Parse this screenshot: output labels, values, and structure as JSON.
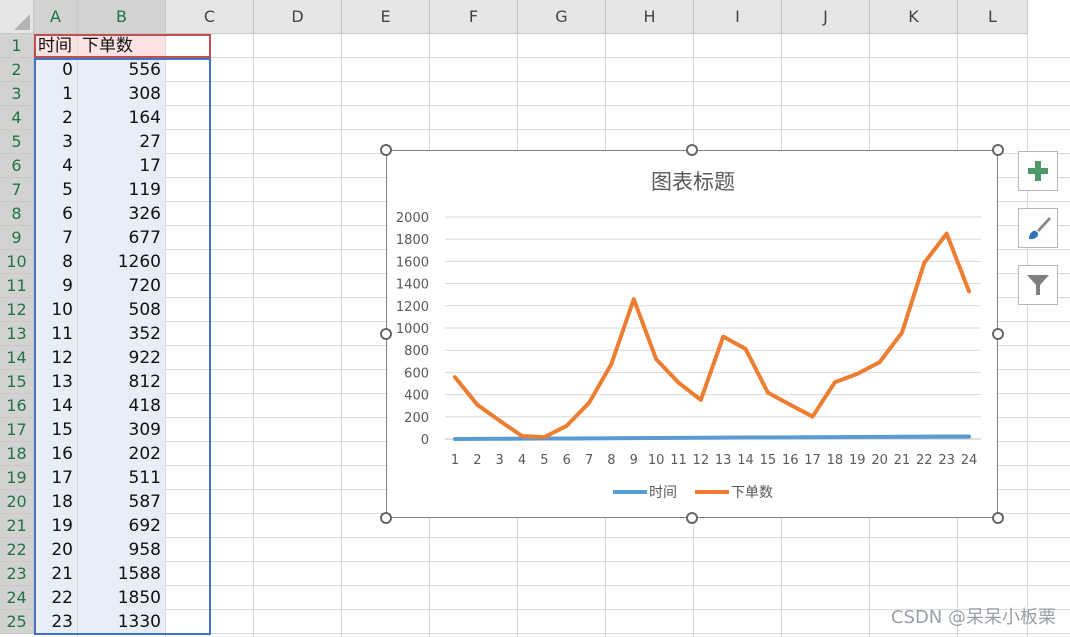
{
  "columns": [
    "A",
    "B",
    "C",
    "D",
    "E",
    "F",
    "G",
    "H",
    "I",
    "J",
    "K",
    "L"
  ],
  "rows": [
    "1",
    "2",
    "3",
    "4",
    "5",
    "6",
    "7",
    "8",
    "9",
    "10",
    "11",
    "12",
    "13",
    "14",
    "15",
    "16",
    "17",
    "18",
    "19",
    "20",
    "21",
    "22",
    "23",
    "24",
    "25"
  ],
  "header": {
    "a": "时间",
    "b": "下单数"
  },
  "table": [
    [
      "0",
      "556"
    ],
    [
      "1",
      "308"
    ],
    [
      "2",
      "164"
    ],
    [
      "3",
      "27"
    ],
    [
      "4",
      "17"
    ],
    [
      "5",
      "119"
    ],
    [
      "6",
      "326"
    ],
    [
      "7",
      "677"
    ],
    [
      "8",
      "1260"
    ],
    [
      "9",
      "720"
    ],
    [
      "10",
      "508"
    ],
    [
      "11",
      "352"
    ],
    [
      "12",
      "922"
    ],
    [
      "13",
      "812"
    ],
    [
      "14",
      "418"
    ],
    [
      "15",
      "309"
    ],
    [
      "16",
      "202"
    ],
    [
      "17",
      "511"
    ],
    [
      "18",
      "587"
    ],
    [
      "19",
      "692"
    ],
    [
      "20",
      "958"
    ],
    [
      "21",
      "1588"
    ],
    [
      "22",
      "1850"
    ],
    [
      "23",
      "1330"
    ]
  ],
  "chart_data": {
    "type": "line",
    "title": "图表标题",
    "categories": [
      "1",
      "2",
      "3",
      "4",
      "5",
      "6",
      "7",
      "8",
      "9",
      "10",
      "11",
      "12",
      "13",
      "14",
      "15",
      "16",
      "17",
      "18",
      "19",
      "20",
      "21",
      "22",
      "23",
      "24"
    ],
    "ylim": [
      0,
      2000
    ],
    "yticks": [
      "0",
      "200",
      "400",
      "600",
      "800",
      "1000",
      "1200",
      "1400",
      "1600",
      "1800",
      "2000"
    ],
    "grid": true,
    "legend_position": "bottom",
    "series": [
      {
        "name": "时间",
        "color": "#5b9bd5",
        "values": [
          0,
          1,
          2,
          3,
          4,
          5,
          6,
          7,
          8,
          9,
          10,
          11,
          12,
          13,
          14,
          15,
          16,
          17,
          18,
          19,
          20,
          21,
          22,
          23
        ]
      },
      {
        "name": "下单数",
        "color": "#ed7d31",
        "values": [
          556,
          308,
          164,
          27,
          17,
          119,
          326,
          677,
          1260,
          720,
          508,
          352,
          922,
          812,
          418,
          309,
          202,
          511,
          587,
          692,
          958,
          1588,
          1850,
          1330
        ]
      }
    ]
  },
  "side_buttons": {
    "add": "plus-icon",
    "style": "brush-icon",
    "filter": "filter-icon"
  },
  "watermark": "CSDN @呆呆小板栗"
}
